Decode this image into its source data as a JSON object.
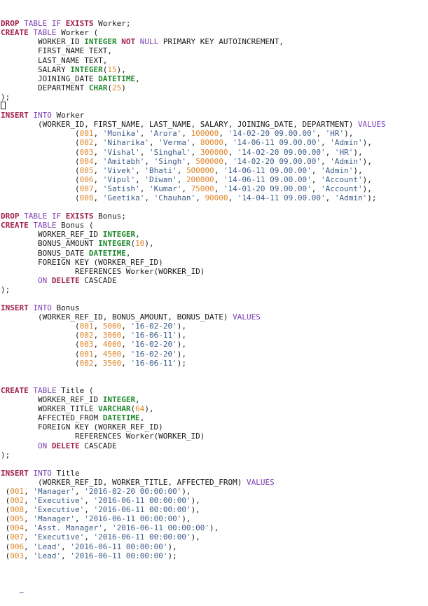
{
  "editor": {
    "end_of_buffer_marker": "~",
    "colors": {
      "keyword_primary": "#a3224f",
      "keyword_secondary": "#7c3fb4",
      "type": "#1f8a2e",
      "number": "#e0862a",
      "string": "#3e5d88",
      "plain": "#1a1a1a"
    },
    "lines": [
      [
        [
          "kw1",
          "DROP"
        ],
        [
          "pl",
          " "
        ],
        [
          "kw2",
          "TABLE"
        ],
        [
          "pl",
          " "
        ],
        [
          "kw2",
          "IF"
        ],
        [
          "pl",
          " "
        ],
        [
          "kw1",
          "EXISTS"
        ],
        [
          "pl",
          " Worker;"
        ]
      ],
      [
        [
          "kw1",
          "CREATE"
        ],
        [
          "pl",
          " "
        ],
        [
          "kw2",
          "TABLE"
        ],
        [
          "pl",
          " Worker ("
        ]
      ],
      [
        [
          "pl",
          "        WORKER_ID "
        ],
        [
          "typ",
          "INTEGER"
        ],
        [
          "pl",
          " "
        ],
        [
          "kw1",
          "NOT"
        ],
        [
          "pl",
          " "
        ],
        [
          "kw2",
          "NULL"
        ],
        [
          "pl",
          " PRIMARY KEY AUTOINCREMENT,"
        ]
      ],
      [
        [
          "pl",
          "        FIRST_NAME TEXT,"
        ]
      ],
      [
        [
          "pl",
          "        LAST_NAME TEXT,"
        ]
      ],
      [
        [
          "pl",
          "        SALARY "
        ],
        [
          "typ",
          "INTEGER"
        ],
        [
          "pl",
          "("
        ],
        [
          "num",
          "15"
        ],
        [
          "pl",
          "),"
        ]
      ],
      [
        [
          "pl",
          "        JOINING_DATE "
        ],
        [
          "typ",
          "DATETIME"
        ],
        [
          "pl",
          ","
        ]
      ],
      [
        [
          "pl",
          "        DEPARTMENT "
        ],
        [
          "typ",
          "CHAR"
        ],
        [
          "pl",
          "("
        ],
        [
          "num",
          "25"
        ],
        [
          "pl",
          ")"
        ]
      ],
      [
        [
          "pl",
          ");"
        ]
      ],
      [
        [
          "cursor",
          ""
        ]
      ],
      [
        [
          "kw1",
          "INSERT"
        ],
        [
          "pl",
          " "
        ],
        [
          "kw2",
          "INTO"
        ],
        [
          "pl",
          " Worker"
        ]
      ],
      [
        [
          "pl",
          "        (WORKER_ID, FIRST_NAME, LAST_NAME, SALARY, JOINING_DATE, DEPARTMENT) "
        ],
        [
          "kw2",
          "VALUES"
        ]
      ],
      [
        [
          "pl",
          "                ("
        ],
        [
          "num",
          "001"
        ],
        [
          "pl",
          ", "
        ],
        [
          "str",
          "'Monika'"
        ],
        [
          "pl",
          ", "
        ],
        [
          "str",
          "'Arora'"
        ],
        [
          "pl",
          ", "
        ],
        [
          "num",
          "100000"
        ],
        [
          "pl",
          ", "
        ],
        [
          "str",
          "'14-02-20 09.00.00'"
        ],
        [
          "pl",
          ", "
        ],
        [
          "str",
          "'HR'"
        ],
        [
          "pl",
          "),"
        ]
      ],
      [
        [
          "pl",
          "                ("
        ],
        [
          "num",
          "002"
        ],
        [
          "pl",
          ", "
        ],
        [
          "str",
          "'Niharika'"
        ],
        [
          "pl",
          ", "
        ],
        [
          "str",
          "'Verma'"
        ],
        [
          "pl",
          ", "
        ],
        [
          "num",
          "80000"
        ],
        [
          "pl",
          ", "
        ],
        [
          "str",
          "'14-06-11 09.00.00'"
        ],
        [
          "pl",
          ", "
        ],
        [
          "str",
          "'Admin'"
        ],
        [
          "pl",
          "),"
        ]
      ],
      [
        [
          "pl",
          "                ("
        ],
        [
          "num",
          "003"
        ],
        [
          "pl",
          ", "
        ],
        [
          "str",
          "'Vishal'"
        ],
        [
          "pl",
          ", "
        ],
        [
          "str",
          "'Singhal'"
        ],
        [
          "pl",
          ", "
        ],
        [
          "num",
          "300000"
        ],
        [
          "pl",
          ", "
        ],
        [
          "str",
          "'14-02-20 09.00.00'"
        ],
        [
          "pl",
          ", "
        ],
        [
          "str",
          "'HR'"
        ],
        [
          "pl",
          "),"
        ]
      ],
      [
        [
          "pl",
          "                ("
        ],
        [
          "num",
          "004"
        ],
        [
          "pl",
          ", "
        ],
        [
          "str",
          "'Amitabh'"
        ],
        [
          "pl",
          ", "
        ],
        [
          "str",
          "'Singh'"
        ],
        [
          "pl",
          ", "
        ],
        [
          "num",
          "500000"
        ],
        [
          "pl",
          ", "
        ],
        [
          "str",
          "'14-02-20 09.00.00'"
        ],
        [
          "pl",
          ", "
        ],
        [
          "str",
          "'Admin'"
        ],
        [
          "pl",
          "),"
        ]
      ],
      [
        [
          "pl",
          "                ("
        ],
        [
          "num",
          "005"
        ],
        [
          "pl",
          ", "
        ],
        [
          "str",
          "'Vivek'"
        ],
        [
          "pl",
          ", "
        ],
        [
          "str",
          "'Bhati'"
        ],
        [
          "pl",
          ", "
        ],
        [
          "num",
          "500000"
        ],
        [
          "pl",
          ", "
        ],
        [
          "str",
          "'14-06-11 09.00.00'"
        ],
        [
          "pl",
          ", "
        ],
        [
          "str",
          "'Admin'"
        ],
        [
          "pl",
          "),"
        ]
      ],
      [
        [
          "pl",
          "                ("
        ],
        [
          "num",
          "006"
        ],
        [
          "pl",
          ", "
        ],
        [
          "str",
          "'Vipul'"
        ],
        [
          "pl",
          ", "
        ],
        [
          "str",
          "'Diwan'"
        ],
        [
          "pl",
          ", "
        ],
        [
          "num",
          "200000"
        ],
        [
          "pl",
          ", "
        ],
        [
          "str",
          "'14-06-11 09.00.00'"
        ],
        [
          "pl",
          ", "
        ],
        [
          "str",
          "'Account'"
        ],
        [
          "pl",
          "),"
        ]
      ],
      [
        [
          "pl",
          "                ("
        ],
        [
          "num",
          "007"
        ],
        [
          "pl",
          ", "
        ],
        [
          "str",
          "'Satish'"
        ],
        [
          "pl",
          ", "
        ],
        [
          "str",
          "'Kumar'"
        ],
        [
          "pl",
          ", "
        ],
        [
          "num",
          "75000"
        ],
        [
          "pl",
          ", "
        ],
        [
          "str",
          "'14-01-20 09.00.00'"
        ],
        [
          "pl",
          ", "
        ],
        [
          "str",
          "'Account'"
        ],
        [
          "pl",
          "),"
        ]
      ],
      [
        [
          "pl",
          "                ("
        ],
        [
          "num",
          "008"
        ],
        [
          "pl",
          ", "
        ],
        [
          "str",
          "'Geetika'"
        ],
        [
          "pl",
          ", "
        ],
        [
          "str",
          "'Chauhan'"
        ],
        [
          "pl",
          ", "
        ],
        [
          "num",
          "90000"
        ],
        [
          "pl",
          ", "
        ],
        [
          "str",
          "'14-04-11 09.00.00'"
        ],
        [
          "pl",
          ", "
        ],
        [
          "str",
          "'Admin'"
        ],
        [
          "pl",
          ");"
        ]
      ],
      [
        [
          "pl",
          ""
        ]
      ],
      [
        [
          "kw1",
          "DROP"
        ],
        [
          "pl",
          " "
        ],
        [
          "kw2",
          "TABLE"
        ],
        [
          "pl",
          " "
        ],
        [
          "kw2",
          "IF"
        ],
        [
          "pl",
          " "
        ],
        [
          "kw1",
          "EXISTS"
        ],
        [
          "pl",
          " Bonus;"
        ]
      ],
      [
        [
          "kw1",
          "CREATE"
        ],
        [
          "pl",
          " "
        ],
        [
          "kw2",
          "TABLE"
        ],
        [
          "pl",
          " Bonus ("
        ]
      ],
      [
        [
          "pl",
          "        WORKER_REF_ID "
        ],
        [
          "typ",
          "INTEGER"
        ],
        [
          "pl",
          ","
        ]
      ],
      [
        [
          "pl",
          "        BONUS_AMOUNT "
        ],
        [
          "typ",
          "INTEGER"
        ],
        [
          "pl",
          "("
        ],
        [
          "num",
          "10"
        ],
        [
          "pl",
          "),"
        ]
      ],
      [
        [
          "pl",
          "        BONUS_DATE "
        ],
        [
          "typ",
          "DATETIME"
        ],
        [
          "pl",
          ","
        ]
      ],
      [
        [
          "pl",
          "        FOREIGN KEY (WORKER_REF_ID)"
        ]
      ],
      [
        [
          "pl",
          "                REFERENCES Worker(WORKER_ID)"
        ]
      ],
      [
        [
          "pl",
          "        "
        ],
        [
          "kw2",
          "ON"
        ],
        [
          "pl",
          " "
        ],
        [
          "kw1",
          "DELETE"
        ],
        [
          "pl",
          " CASCADE"
        ]
      ],
      [
        [
          "pl",
          ");"
        ]
      ],
      [
        [
          "pl",
          ""
        ]
      ],
      [
        [
          "kw1",
          "INSERT"
        ],
        [
          "pl",
          " "
        ],
        [
          "kw2",
          "INTO"
        ],
        [
          "pl",
          " Bonus"
        ]
      ],
      [
        [
          "pl",
          "        (WORKER_REF_ID, BONUS_AMOUNT, BONUS_DATE) "
        ],
        [
          "kw2",
          "VALUES"
        ]
      ],
      [
        [
          "pl",
          "                ("
        ],
        [
          "num",
          "001"
        ],
        [
          "pl",
          ", "
        ],
        [
          "num",
          "5000"
        ],
        [
          "pl",
          ", "
        ],
        [
          "str",
          "'16-02-20'"
        ],
        [
          "pl",
          "),"
        ]
      ],
      [
        [
          "pl",
          "                ("
        ],
        [
          "num",
          "002"
        ],
        [
          "pl",
          ", "
        ],
        [
          "num",
          "3000"
        ],
        [
          "pl",
          ", "
        ],
        [
          "str",
          "'16-06-11'"
        ],
        [
          "pl",
          "),"
        ]
      ],
      [
        [
          "pl",
          "                ("
        ],
        [
          "num",
          "003"
        ],
        [
          "pl",
          ", "
        ],
        [
          "num",
          "4000"
        ],
        [
          "pl",
          ", "
        ],
        [
          "str",
          "'16-02-20'"
        ],
        [
          "pl",
          "),"
        ]
      ],
      [
        [
          "pl",
          "                ("
        ],
        [
          "num",
          "001"
        ],
        [
          "pl",
          ", "
        ],
        [
          "num",
          "4500"
        ],
        [
          "pl",
          ", "
        ],
        [
          "str",
          "'16-02-20'"
        ],
        [
          "pl",
          "),"
        ]
      ],
      [
        [
          "pl",
          "                ("
        ],
        [
          "num",
          "002"
        ],
        [
          "pl",
          ", "
        ],
        [
          "num",
          "3500"
        ],
        [
          "pl",
          ", "
        ],
        [
          "str",
          "'16-06-11'"
        ],
        [
          "pl",
          ");"
        ]
      ],
      [
        [
          "pl",
          ""
        ]
      ],
      [
        [
          "pl",
          ""
        ]
      ],
      [
        [
          "kw1",
          "CREATE"
        ],
        [
          "pl",
          " "
        ],
        [
          "kw2",
          "TABLE"
        ],
        [
          "pl",
          " Title ("
        ]
      ],
      [
        [
          "pl",
          "        WORKER_REF_ID "
        ],
        [
          "typ",
          "INTEGER"
        ],
        [
          "pl",
          ","
        ]
      ],
      [
        [
          "pl",
          "        WORKER_TITLE "
        ],
        [
          "typ",
          "VARCHAR"
        ],
        [
          "pl",
          "("
        ],
        [
          "num",
          "64"
        ],
        [
          "pl",
          "),"
        ]
      ],
      [
        [
          "pl",
          "        AFFECTED_FROM "
        ],
        [
          "typ",
          "DATETIME"
        ],
        [
          "pl",
          ","
        ]
      ],
      [
        [
          "pl",
          "        FOREIGN KEY (WORKER_REF_ID)"
        ]
      ],
      [
        [
          "pl",
          "                REFERENCES Worker(WORKER_ID)"
        ]
      ],
      [
        [
          "pl",
          "        "
        ],
        [
          "kw2",
          "ON"
        ],
        [
          "pl",
          " "
        ],
        [
          "kw1",
          "DELETE"
        ],
        [
          "pl",
          " CASCADE"
        ]
      ],
      [
        [
          "pl",
          ");"
        ]
      ],
      [
        [
          "pl",
          ""
        ]
      ],
      [
        [
          "kw1",
          "INSERT"
        ],
        [
          "pl",
          " "
        ],
        [
          "kw2",
          "INTO"
        ],
        [
          "pl",
          " Title"
        ]
      ],
      [
        [
          "pl",
          "        (WORKER_REF_ID, WORKER_TITLE, AFFECTED_FROM) "
        ],
        [
          "kw2",
          "VALUES"
        ]
      ],
      [
        [
          "pl",
          " ("
        ],
        [
          "num",
          "001"
        ],
        [
          "pl",
          ", "
        ],
        [
          "str",
          "'Manager'"
        ],
        [
          "pl",
          ", "
        ],
        [
          "str",
          "'2016-02-20 00:00:00'"
        ],
        [
          "pl",
          "),"
        ]
      ],
      [
        [
          "pl",
          " ("
        ],
        [
          "num",
          "002"
        ],
        [
          "pl",
          ", "
        ],
        [
          "str",
          "'Executive'"
        ],
        [
          "pl",
          ", "
        ],
        [
          "str",
          "'2016-06-11 00:00:00'"
        ],
        [
          "pl",
          "),"
        ]
      ],
      [
        [
          "pl",
          " ("
        ],
        [
          "num",
          "008"
        ],
        [
          "pl",
          ", "
        ],
        [
          "str",
          "'Executive'"
        ],
        [
          "pl",
          ", "
        ],
        [
          "str",
          "'2016-06-11 00:00:00'"
        ],
        [
          "pl",
          "),"
        ]
      ],
      [
        [
          "pl",
          " ("
        ],
        [
          "num",
          "005"
        ],
        [
          "pl",
          ", "
        ],
        [
          "str",
          "'Manager'"
        ],
        [
          "pl",
          ", "
        ],
        [
          "str",
          "'2016-06-11 00:00:00'"
        ],
        [
          "pl",
          "),"
        ]
      ],
      [
        [
          "pl",
          " ("
        ],
        [
          "num",
          "004"
        ],
        [
          "pl",
          ", "
        ],
        [
          "str",
          "'Asst. Manager'"
        ],
        [
          "pl",
          ", "
        ],
        [
          "str",
          "'2016-06-11 00:00:00'"
        ],
        [
          "pl",
          "),"
        ]
      ],
      [
        [
          "pl",
          " ("
        ],
        [
          "num",
          "007"
        ],
        [
          "pl",
          ", "
        ],
        [
          "str",
          "'Executive'"
        ],
        [
          "pl",
          ", "
        ],
        [
          "str",
          "'2016-06-11 00:00:00'"
        ],
        [
          "pl",
          "),"
        ]
      ],
      [
        [
          "pl",
          " ("
        ],
        [
          "num",
          "006"
        ],
        [
          "pl",
          ", "
        ],
        [
          "str",
          "'Lead'"
        ],
        [
          "pl",
          ", "
        ],
        [
          "str",
          "'2016-06-11 00:00:00'"
        ],
        [
          "pl",
          "),"
        ]
      ],
      [
        [
          "pl",
          " ("
        ],
        [
          "num",
          "003"
        ],
        [
          "pl",
          ", "
        ],
        [
          "str",
          "'Lead'"
        ],
        [
          "pl",
          ", "
        ],
        [
          "str",
          "'2016-06-11 00:00:00'"
        ],
        [
          "pl",
          ");"
        ]
      ]
    ]
  }
}
